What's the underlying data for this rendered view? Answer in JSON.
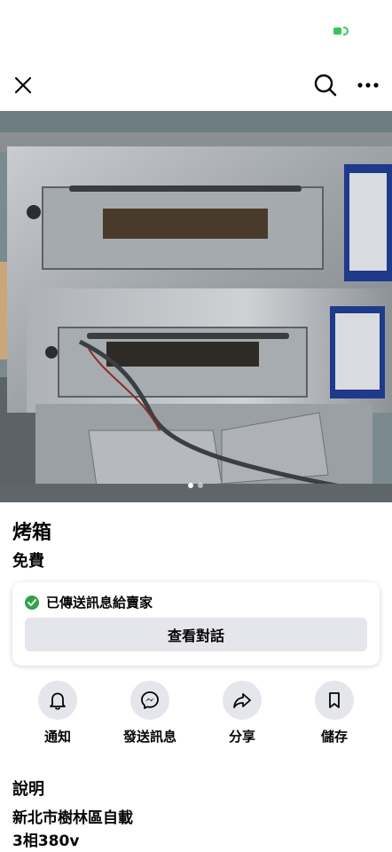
{
  "status_bar": {
    "battery_color": "#34c759"
  },
  "nav": {
    "close_icon": "close-icon",
    "search_icon": "search-icon",
    "more_icon": "more-horizontal-icon"
  },
  "photo": {
    "page_count": 2,
    "current_page": 1
  },
  "listing": {
    "title": "烤箱",
    "price": "免費"
  },
  "message": {
    "status": "已傳送訊息給賣家",
    "view_button": "查看對話",
    "status_color": "#31a24c"
  },
  "actions": [
    {
      "label": "通知",
      "icon": "bell-icon"
    },
    {
      "label": "發送訊息",
      "icon": "messenger-icon"
    },
    {
      "label": "分享",
      "icon": "share-icon"
    },
    {
      "label": "儲存",
      "icon": "bookmark-icon"
    }
  ],
  "description": {
    "heading": "說明",
    "lines": [
      "新北市樹林區自載",
      "3相380v"
    ]
  }
}
